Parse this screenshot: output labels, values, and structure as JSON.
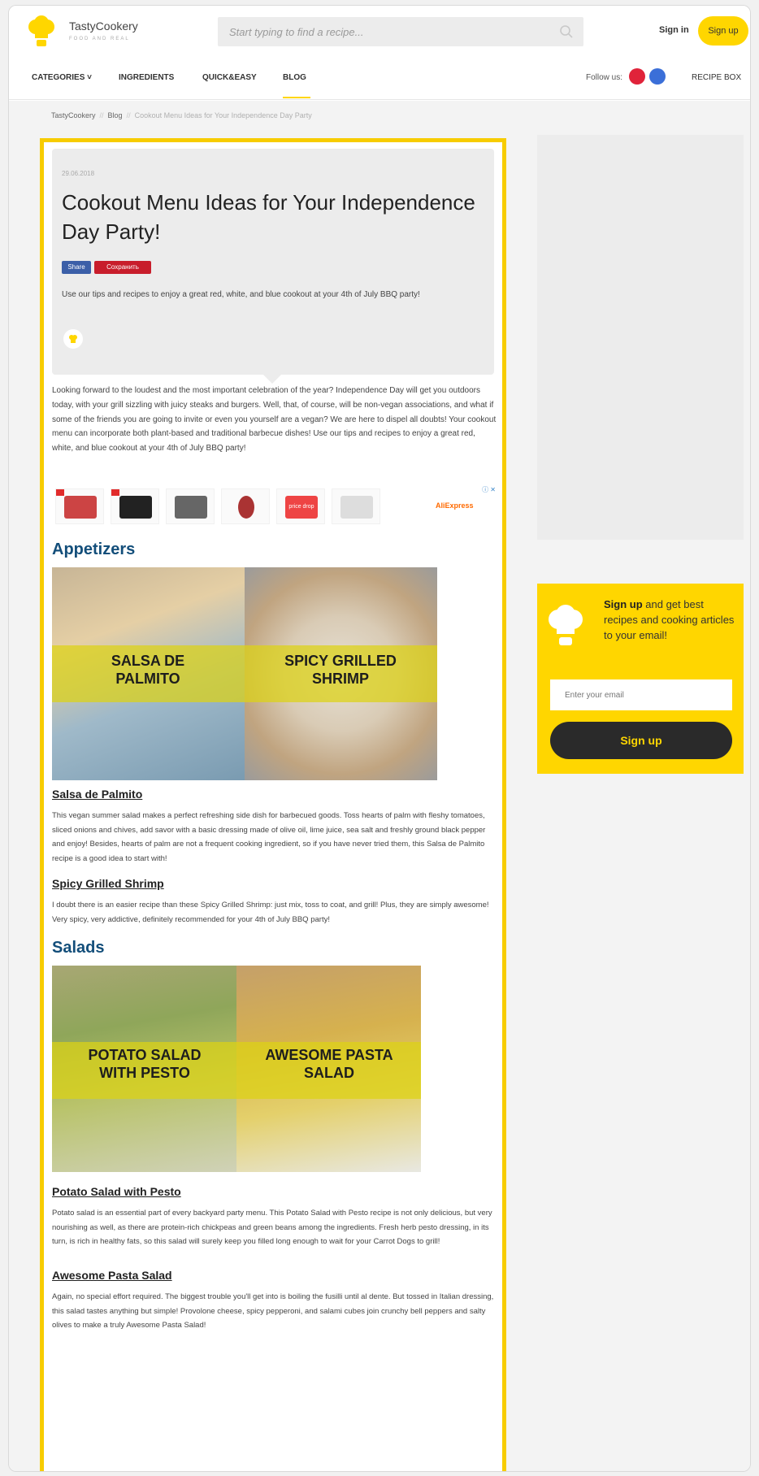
{
  "header": {
    "logo_name": "TastyCookery",
    "logo_tagline": "FOOD AND REAL",
    "search_placeholder": "Start typing to find a recipe...",
    "sign_in": "Sign in",
    "sign_up": "Sign up"
  },
  "nav": {
    "items": [
      "CATEGORIES ˅",
      "INGREDIENTS",
      "QUICK&EASY",
      "BLOG"
    ],
    "follow_label": "Follow us:",
    "recipe_box": "RECIPE BOX"
  },
  "breadcrumb": [
    "TastyCookery",
    "Blog",
    "Cookout Menu Ideas for Your Independence Day Party"
  ],
  "article": {
    "date": "29.06.2018",
    "title": "Cookout Menu Ideas for Your Independence Day Party!",
    "share_label": "Share",
    "save_label": "Сохранить",
    "description": "Use our tips and recipes to enjoy a great red, white, and blue cookout at your 4th of July BBQ party!",
    "intro": "Looking forward to the loudest and the most important celebration of the year? Independence Day will get you outdoors today, with your grill sizzling with juicy steaks and burgers. Well, that, of course, will be non-vegan associations, and what if some of the friends you are going to invite or even you yourself are a vegan? We are here to dispel all doubts! Your cookout menu can incorporate both plant-based and traditional barbecue dishes! Use our tips and recipes to enjoy a great red, white, and blue cookout at your 4th of July BBQ party!"
  },
  "ad": {
    "brand": "AliExpress",
    "promo_label": "price drop",
    "close_label": "ⓘ ✕"
  },
  "sections": {
    "appetizers": {
      "heading": "Appetizers",
      "image_left_caption": "SALSA DE PALMITO",
      "image_right_caption": "SPICY GRILLED SHRIMP",
      "item1_title": "Salsa de Palmito",
      "item1_text": "This vegan summer salad makes a perfect refreshing side dish for barbecued goods. Toss hearts of palm with fleshy tomatoes, sliced onions and chives, add savor with a basic dressing made of olive oil, lime juice, sea salt and freshly ground black pepper and enjoy! Besides, hearts of palm are not a frequent cooking ingredient, so if you have never tried them, this Salsa de Palmito recipe is a good idea to start with!",
      "item2_title": "Spicy Grilled Shrimp",
      "item2_text": "I doubt there is an easier recipe than these Spicy Grilled Shrimp: just mix, toss to coat, and grill! Plus, they are simply awesome! Very spicy, very addictive, definitely recommended for your 4th of July BBQ party!"
    },
    "salads": {
      "heading": "Salads",
      "image_left_caption": "POTATO SALAD WITH PESTO",
      "image_right_caption": "AWESOME PASTA SALAD",
      "item1_title": "Potato Salad with Pesto",
      "item1_text": "Potato salad is an essential part of every backyard party menu. This Potato Salad with Pesto recipe is not only delicious, but very nourishing as well, as there are protein-rich chickpeas and green beans among the ingredients. Fresh herb pesto dressing, in its turn, is rich in healthy fats, so this salad will surely keep you filled long enough to wait for your Carrot Dogs to grill!",
      "item2_title": "Awesome Pasta Salad",
      "item2_text": "Again, no special effort required. The biggest trouble you'll get into is boiling the fusilli until al dente. But tossed in Italian dressing, this salad tastes anything but simple! Provolone cheese, spicy pepperoni, and salami cubes join crunchy bell peppers and salty olives to make a truly Awesome Pasta Salad!"
    }
  },
  "sidebar": {
    "signup_bold": "Sign up",
    "signup_rest": " and get best recipes and cooking articles to your email!",
    "email_placeholder": "Enter your email",
    "signup_button": "Sign up"
  },
  "colors": {
    "brand_yellow": "#ffd600",
    "frame_yellow": "#f7cc00",
    "heading_blue": "#134e7a"
  }
}
